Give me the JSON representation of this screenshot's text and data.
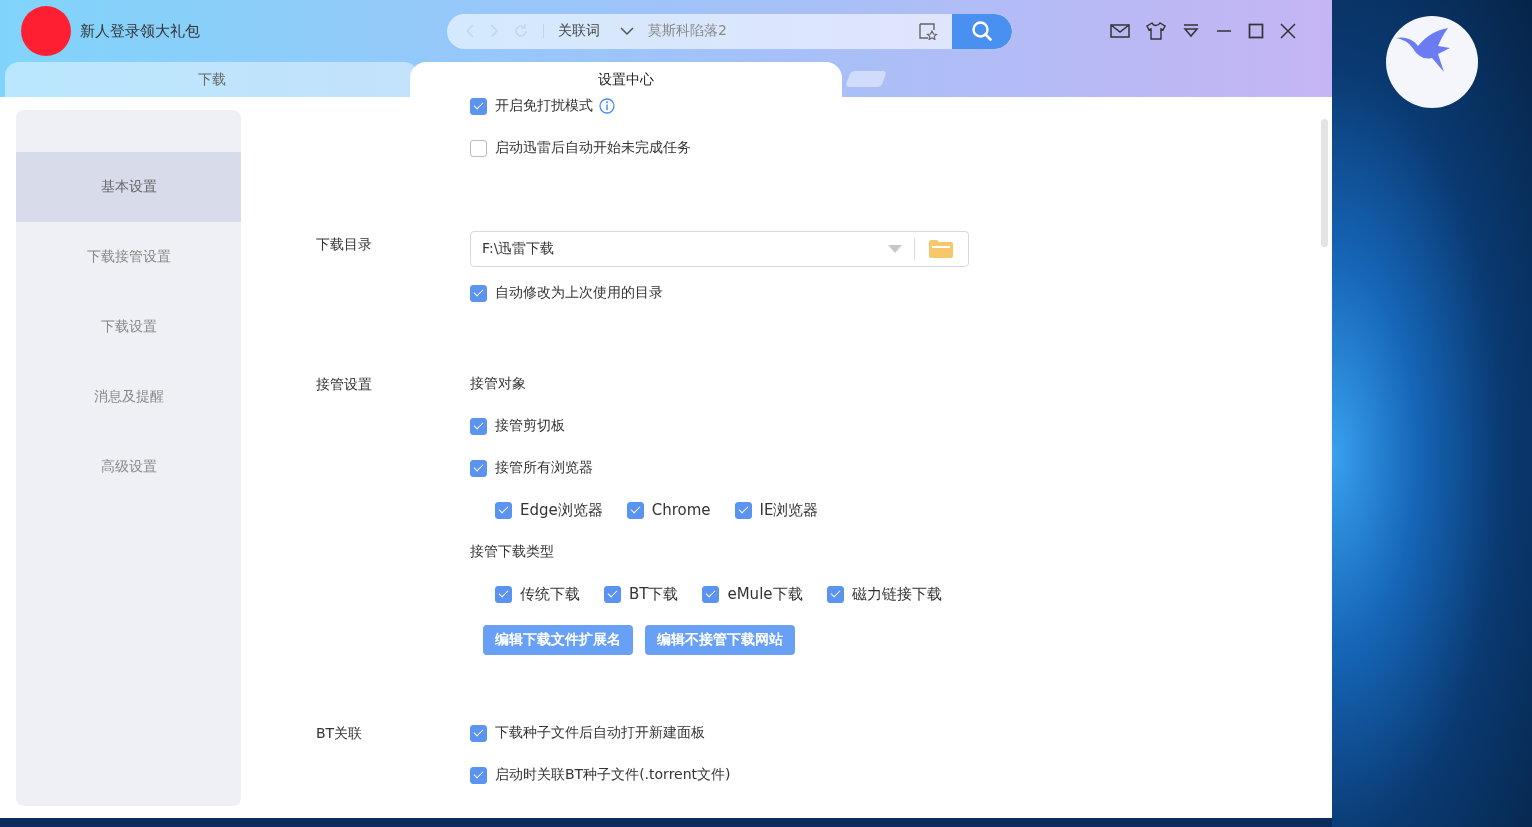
{
  "app": {
    "user_label": "新人登录领大礼包"
  },
  "search": {
    "keyword_type": "关联词",
    "value": "莫斯科陷落2"
  },
  "tabs": [
    {
      "label": "下载",
      "selected": false
    },
    {
      "label": "设置中心",
      "selected": true
    }
  ],
  "sidebar": {
    "items": [
      {
        "label": "基本设置",
        "selected": true
      },
      {
        "label": "下载接管设置",
        "selected": false
      },
      {
        "label": "下载设置",
        "selected": false
      },
      {
        "label": "消息及提醒",
        "selected": false
      },
      {
        "label": "高级设置",
        "selected": false
      }
    ]
  },
  "sections": [
    {
      "rows": [
        {
          "kind": "checkbox",
          "label": "开启免打扰模式",
          "checked": true,
          "info": true
        },
        {
          "kind": "checkbox",
          "label": "启动迅雷后自动开始未完成任务",
          "checked": false
        }
      ]
    },
    {
      "label": "下载目录",
      "rows": [
        {
          "kind": "path",
          "value": "F:\\迅雷下载"
        },
        {
          "kind": "checkbox",
          "label": "自动修改为上次使用的目录",
          "checked": true
        }
      ]
    },
    {
      "label": "接管设置",
      "rows": [
        {
          "kind": "heading",
          "label": "接管对象"
        },
        {
          "kind": "checkbox",
          "label": "接管剪切板",
          "checked": true
        },
        {
          "kind": "checkbox",
          "label": "接管所有浏览器",
          "checked": true
        },
        {
          "kind": "group",
          "items": [
            {
              "label": "Edge浏览器",
              "checked": true
            },
            {
              "label": "Chrome",
              "checked": true
            },
            {
              "label": "IE浏览器",
              "checked": true
            }
          ]
        },
        {
          "kind": "heading",
          "label": "接管下载类型"
        },
        {
          "kind": "group",
          "items": [
            {
              "label": "传统下载",
              "checked": true
            },
            {
              "label": "BT下载",
              "checked": true
            },
            {
              "label": "eMule下载",
              "checked": true
            },
            {
              "label": "磁力链接下载",
              "checked": true
            }
          ]
        },
        {
          "kind": "buttons",
          "items": [
            "编辑下载文件扩展名",
            "编辑不接管下载网站"
          ]
        }
      ]
    },
    {
      "label": "BT关联",
      "rows": [
        {
          "kind": "checkbox",
          "label": "下载种子文件后自动打开新建面板",
          "checked": true
        },
        {
          "kind": "checkbox",
          "label": "启动时关联BT种子文件(.torrent文件)",
          "checked": true
        }
      ]
    }
  ]
}
